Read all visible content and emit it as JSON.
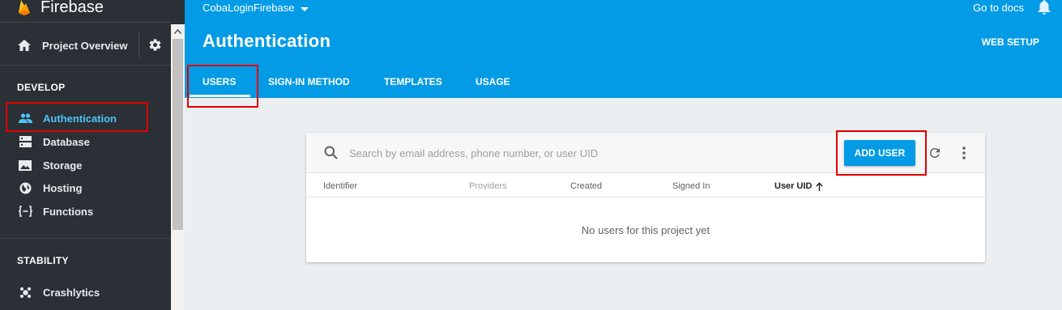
{
  "sidebar": {
    "brand": "Firebase",
    "overview_label": "Project Overview",
    "sections": [
      {
        "title": "DEVELOP",
        "items": [
          {
            "label": "Authentication",
            "icon": "people-icon",
            "active": true
          },
          {
            "label": "Database",
            "icon": "database-icon",
            "active": false
          },
          {
            "label": "Storage",
            "icon": "image-icon",
            "active": false
          },
          {
            "label": "Hosting",
            "icon": "globe-icon",
            "active": false
          },
          {
            "label": "Functions",
            "icon": "functions-icon",
            "active": false
          }
        ]
      },
      {
        "title": "STABILITY",
        "items": [
          {
            "label": "Crashlytics",
            "icon": "crashlytics-icon",
            "active": false
          }
        ]
      }
    ]
  },
  "header": {
    "project_name": "CobaLoginFirebase",
    "docs_link": "Go to docs",
    "title": "Authentication",
    "web_setup": "WEB SETUP",
    "tabs": [
      {
        "label": "USERS",
        "active": true
      },
      {
        "label": "SIGN-IN METHOD",
        "active": false
      },
      {
        "label": "TEMPLATES",
        "active": false
      },
      {
        "label": "USAGE",
        "active": false
      }
    ]
  },
  "users_card": {
    "search_placeholder": "Search by email address, phone number, or user UID",
    "add_user_label": "ADD USER",
    "columns": [
      "Identifier",
      "Providers",
      "Created",
      "Signed In",
      "User UID"
    ],
    "sorted_column": "User UID",
    "empty_message": "No users for this project yet"
  },
  "colors": {
    "accent": "#039be5",
    "sidebar_bg": "#2b3036",
    "active_nav": "#4fc3f7",
    "highlight": "#e00000"
  }
}
